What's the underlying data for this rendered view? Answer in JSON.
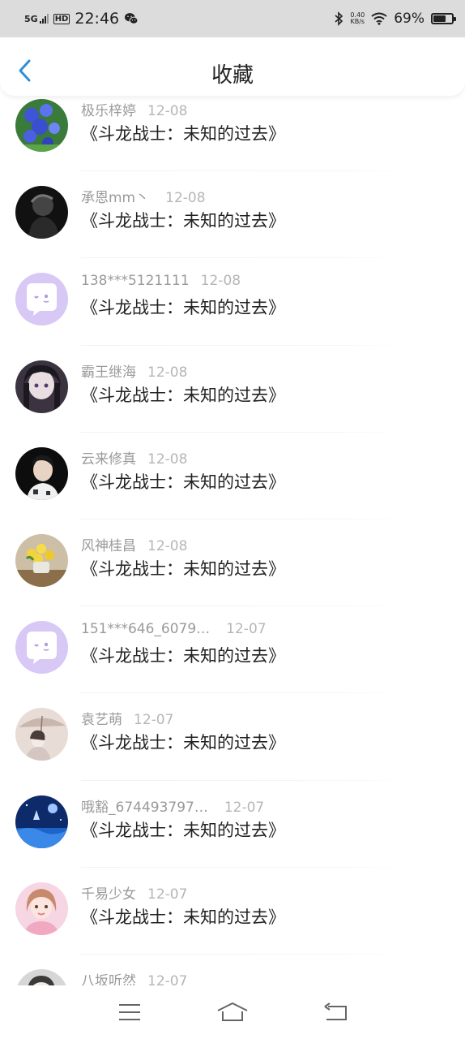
{
  "status_bar": {
    "network": "5G",
    "hd": "HD",
    "time": "22:46",
    "speed_value": "0.40",
    "speed_unit": "KB/s",
    "battery_percent": "69%",
    "battery_level": 0.69
  },
  "nav": {
    "title": "收藏"
  },
  "favorites": [
    {
      "user": "极乐梓婷",
      "date": "12-08",
      "book": "《斗龙战士：未知的过去》",
      "avatar": "blue-flowers"
    },
    {
      "user": "承恩mm丶",
      "date": "12-08",
      "book": "《斗龙战士：未知的过去》",
      "avatar": "dark-portrait"
    },
    {
      "user": "138***5121111",
      "date": "12-08",
      "book": "《斗龙战士：未知的过去》",
      "avatar": "default-chat"
    },
    {
      "user": "霸王继海",
      "date": "12-08",
      "book": "《斗龙战士：未知的过去》",
      "avatar": "anime-girl"
    },
    {
      "user": "云来修真",
      "date": "12-08",
      "book": "《斗龙战士：未知的过去》",
      "avatar": "young-man"
    },
    {
      "user": "风神桂昌",
      "date": "12-08",
      "book": "《斗龙战士：未知的过去》",
      "avatar": "yellow-flowers"
    },
    {
      "user": "151***646_6079…",
      "date": "12-07",
      "book": "《斗龙战士：未知的过去》",
      "avatar": "default-chat"
    },
    {
      "user": "袁艺萌",
      "date": "12-07",
      "book": "《斗龙战士：未知的过去》",
      "avatar": "umbrella-girl"
    },
    {
      "user": "哦豁_674493797…",
      "date": "12-07",
      "book": "《斗龙战士：未知的过去》",
      "avatar": "blue-night"
    },
    {
      "user": "千易少女",
      "date": "12-07",
      "book": "《斗龙战士：未知的过去》",
      "avatar": "pink-girl"
    },
    {
      "user": "八坂听然",
      "date": "12-07",
      "book": "",
      "avatar": "gray-portrait"
    }
  ],
  "bottom_nav": {
    "menu": "menu-icon",
    "home": "home-icon",
    "back": "back-icon"
  }
}
